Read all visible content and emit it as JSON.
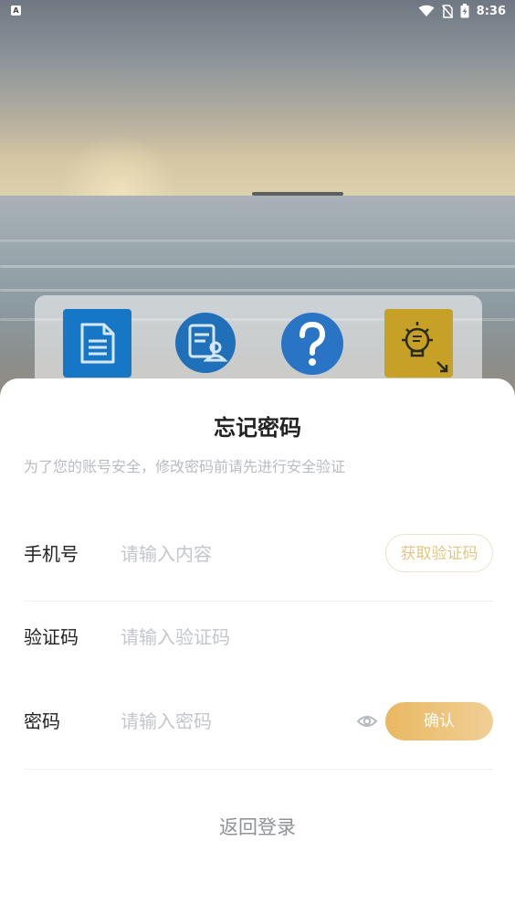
{
  "status_bar": {
    "time": "8:36",
    "left_icon": "A",
    "icons": [
      "wifi-icon",
      "no-sim-icon",
      "battery-charging-icon"
    ]
  },
  "shortcuts": [
    {
      "icon": "document-icon",
      "color": "#1677c7"
    },
    {
      "icon": "certificate-user-icon",
      "color": "#1f6fb9"
    },
    {
      "icon": "help-question-icon",
      "color": "#2a74c6"
    },
    {
      "icon": "lightbulb-idea-icon",
      "color": "#c6a126"
    }
  ],
  "sheet": {
    "title": "忘记密码",
    "subtitle": "为了您的账号安全，修改密码前请先进行安全验证",
    "phone": {
      "label": "手机号",
      "value": "",
      "placeholder": "请输入内容",
      "get_code_label": "获取验证码"
    },
    "code": {
      "label": "验证码",
      "value": "",
      "placeholder": "请输入验证码"
    },
    "password": {
      "label": "密码",
      "value": "",
      "placeholder": "请输入密码",
      "confirm_label": "确认"
    },
    "back_to_login": "返回登录"
  },
  "colors": {
    "accent_gold": "#e9b863",
    "placeholder": "#c3c6cb",
    "subtitle": "#b8bcc2"
  }
}
